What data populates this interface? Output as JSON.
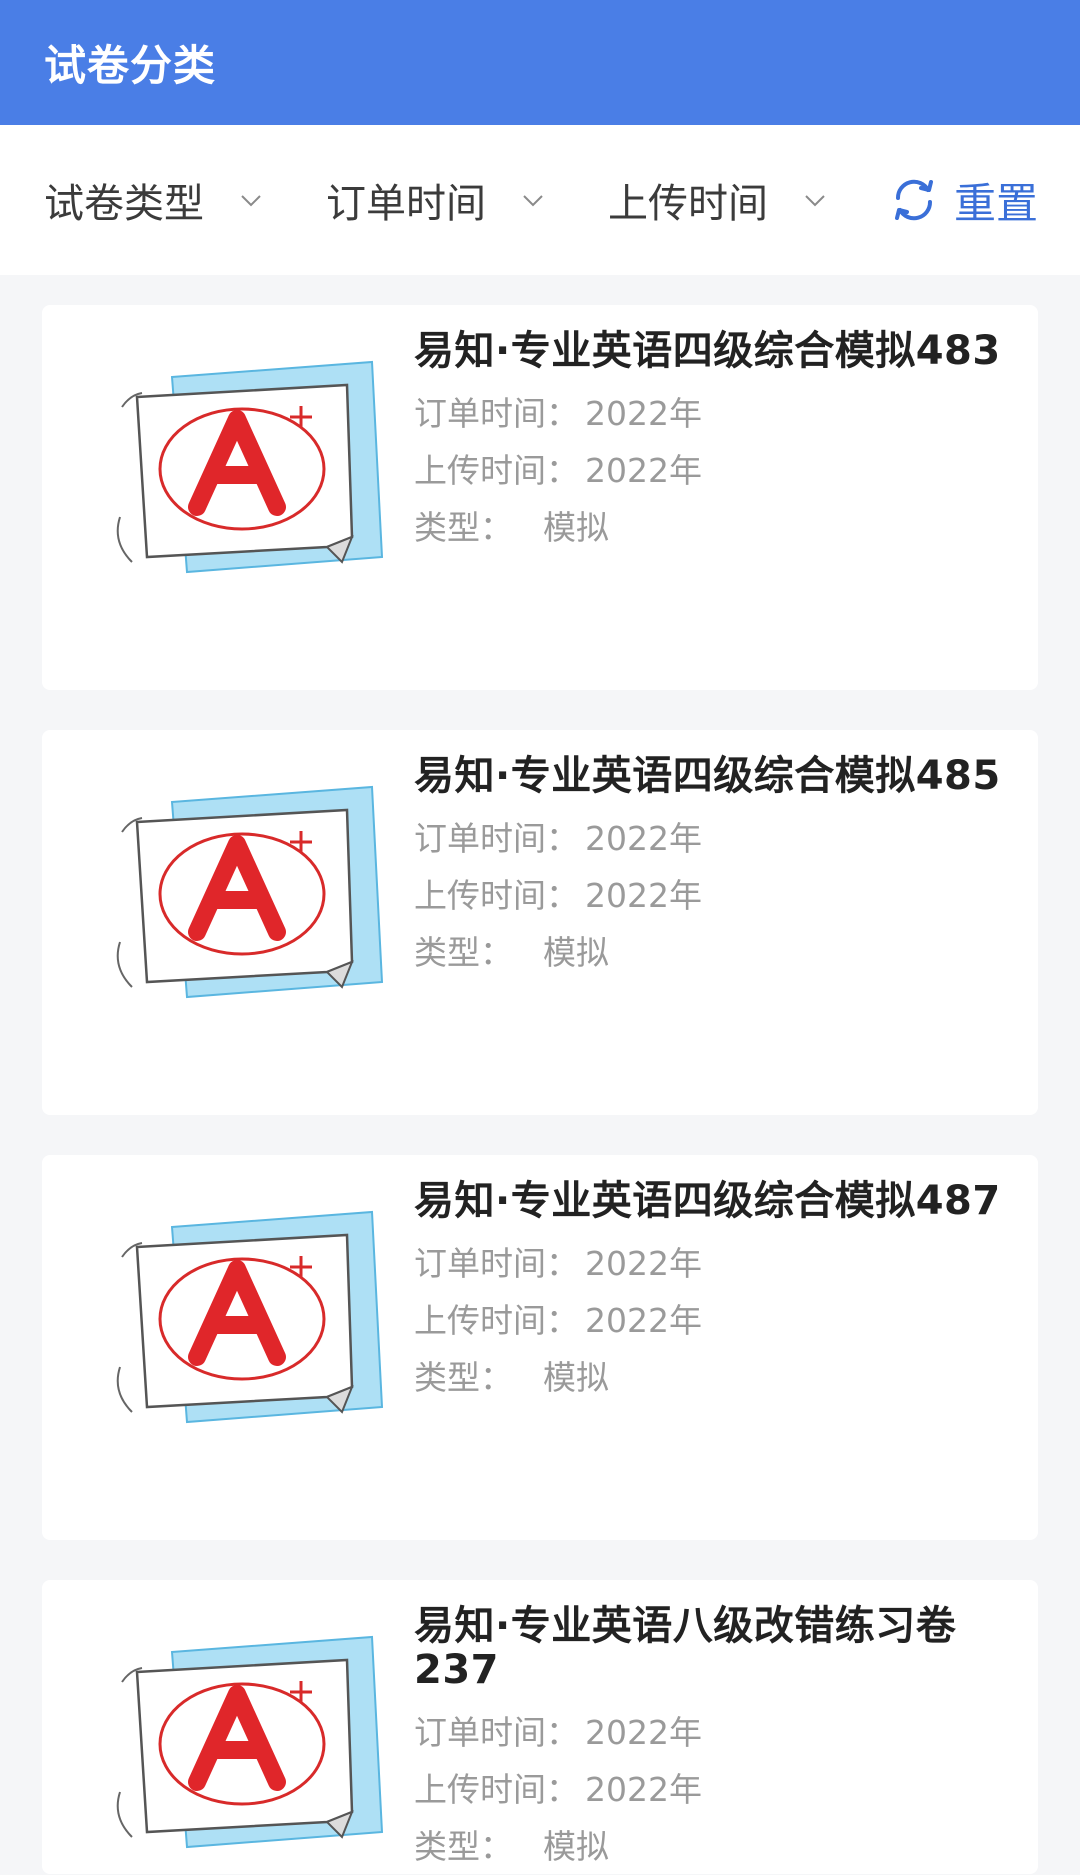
{
  "header": {
    "title": "试卷分类"
  },
  "filters": {
    "paper_type": "试卷类型",
    "order_time": "订单时间",
    "upload_time": "上传时间",
    "reset": "重置"
  },
  "labels": {
    "order_time": "订单时间：",
    "upload_time": "上传时间：",
    "type": "类型："
  },
  "items": [
    {
      "title": "易知·专业英语四级综合模拟483",
      "order_time": "2022年",
      "upload_time": "2022年",
      "type": "模拟"
    },
    {
      "title": "易知·专业英语四级综合模拟485",
      "order_time": "2022年",
      "upload_time": "2022年",
      "type": "模拟"
    },
    {
      "title": "易知·专业英语四级综合模拟487",
      "order_time": "2022年",
      "upload_time": "2022年",
      "type": "模拟"
    },
    {
      "title": "易知·专业英语八级改错练习卷237",
      "order_time": "2022年",
      "upload_time": "2022年",
      "type": "模拟"
    }
  ],
  "thumbnail": {
    "grade": "A",
    "sup": "+"
  },
  "colors": {
    "header": "#4a7ee6",
    "accent": "#3a6fd8",
    "grade_red": "#e0262a"
  }
}
